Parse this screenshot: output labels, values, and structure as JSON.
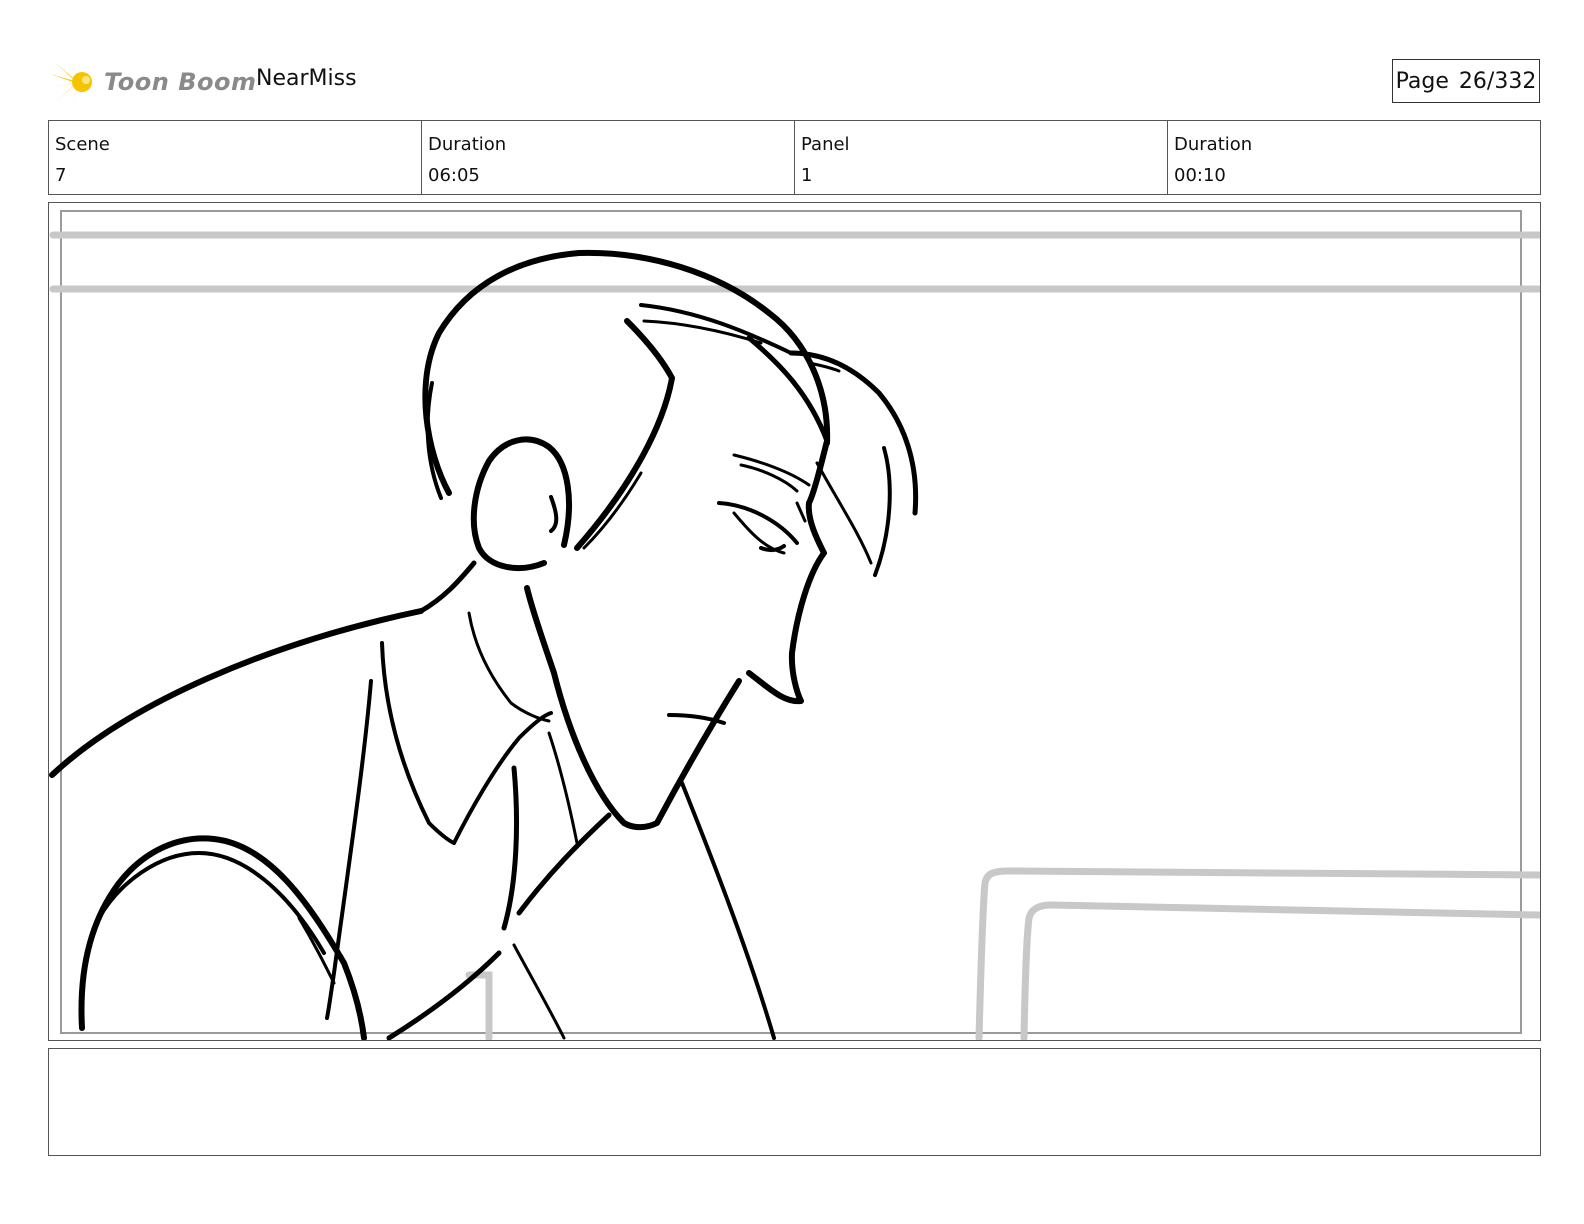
{
  "header": {
    "logo_text": "Toon Boom",
    "project_name": "NearMiss",
    "page_label": "Page",
    "page_number": "26/332"
  },
  "info": [
    {
      "label": "Scene",
      "value": "7"
    },
    {
      "label": "Duration",
      "value": "06:05"
    },
    {
      "label": "Panel",
      "value": "1"
    },
    {
      "label": "Duration",
      "value": "00:10"
    }
  ],
  "colors": {
    "logo_yellow": "#f5c400",
    "logo_gray": "#8a8a8a",
    "sketch_ink": "#000000",
    "sketch_guide": "#c8c8c8"
  }
}
